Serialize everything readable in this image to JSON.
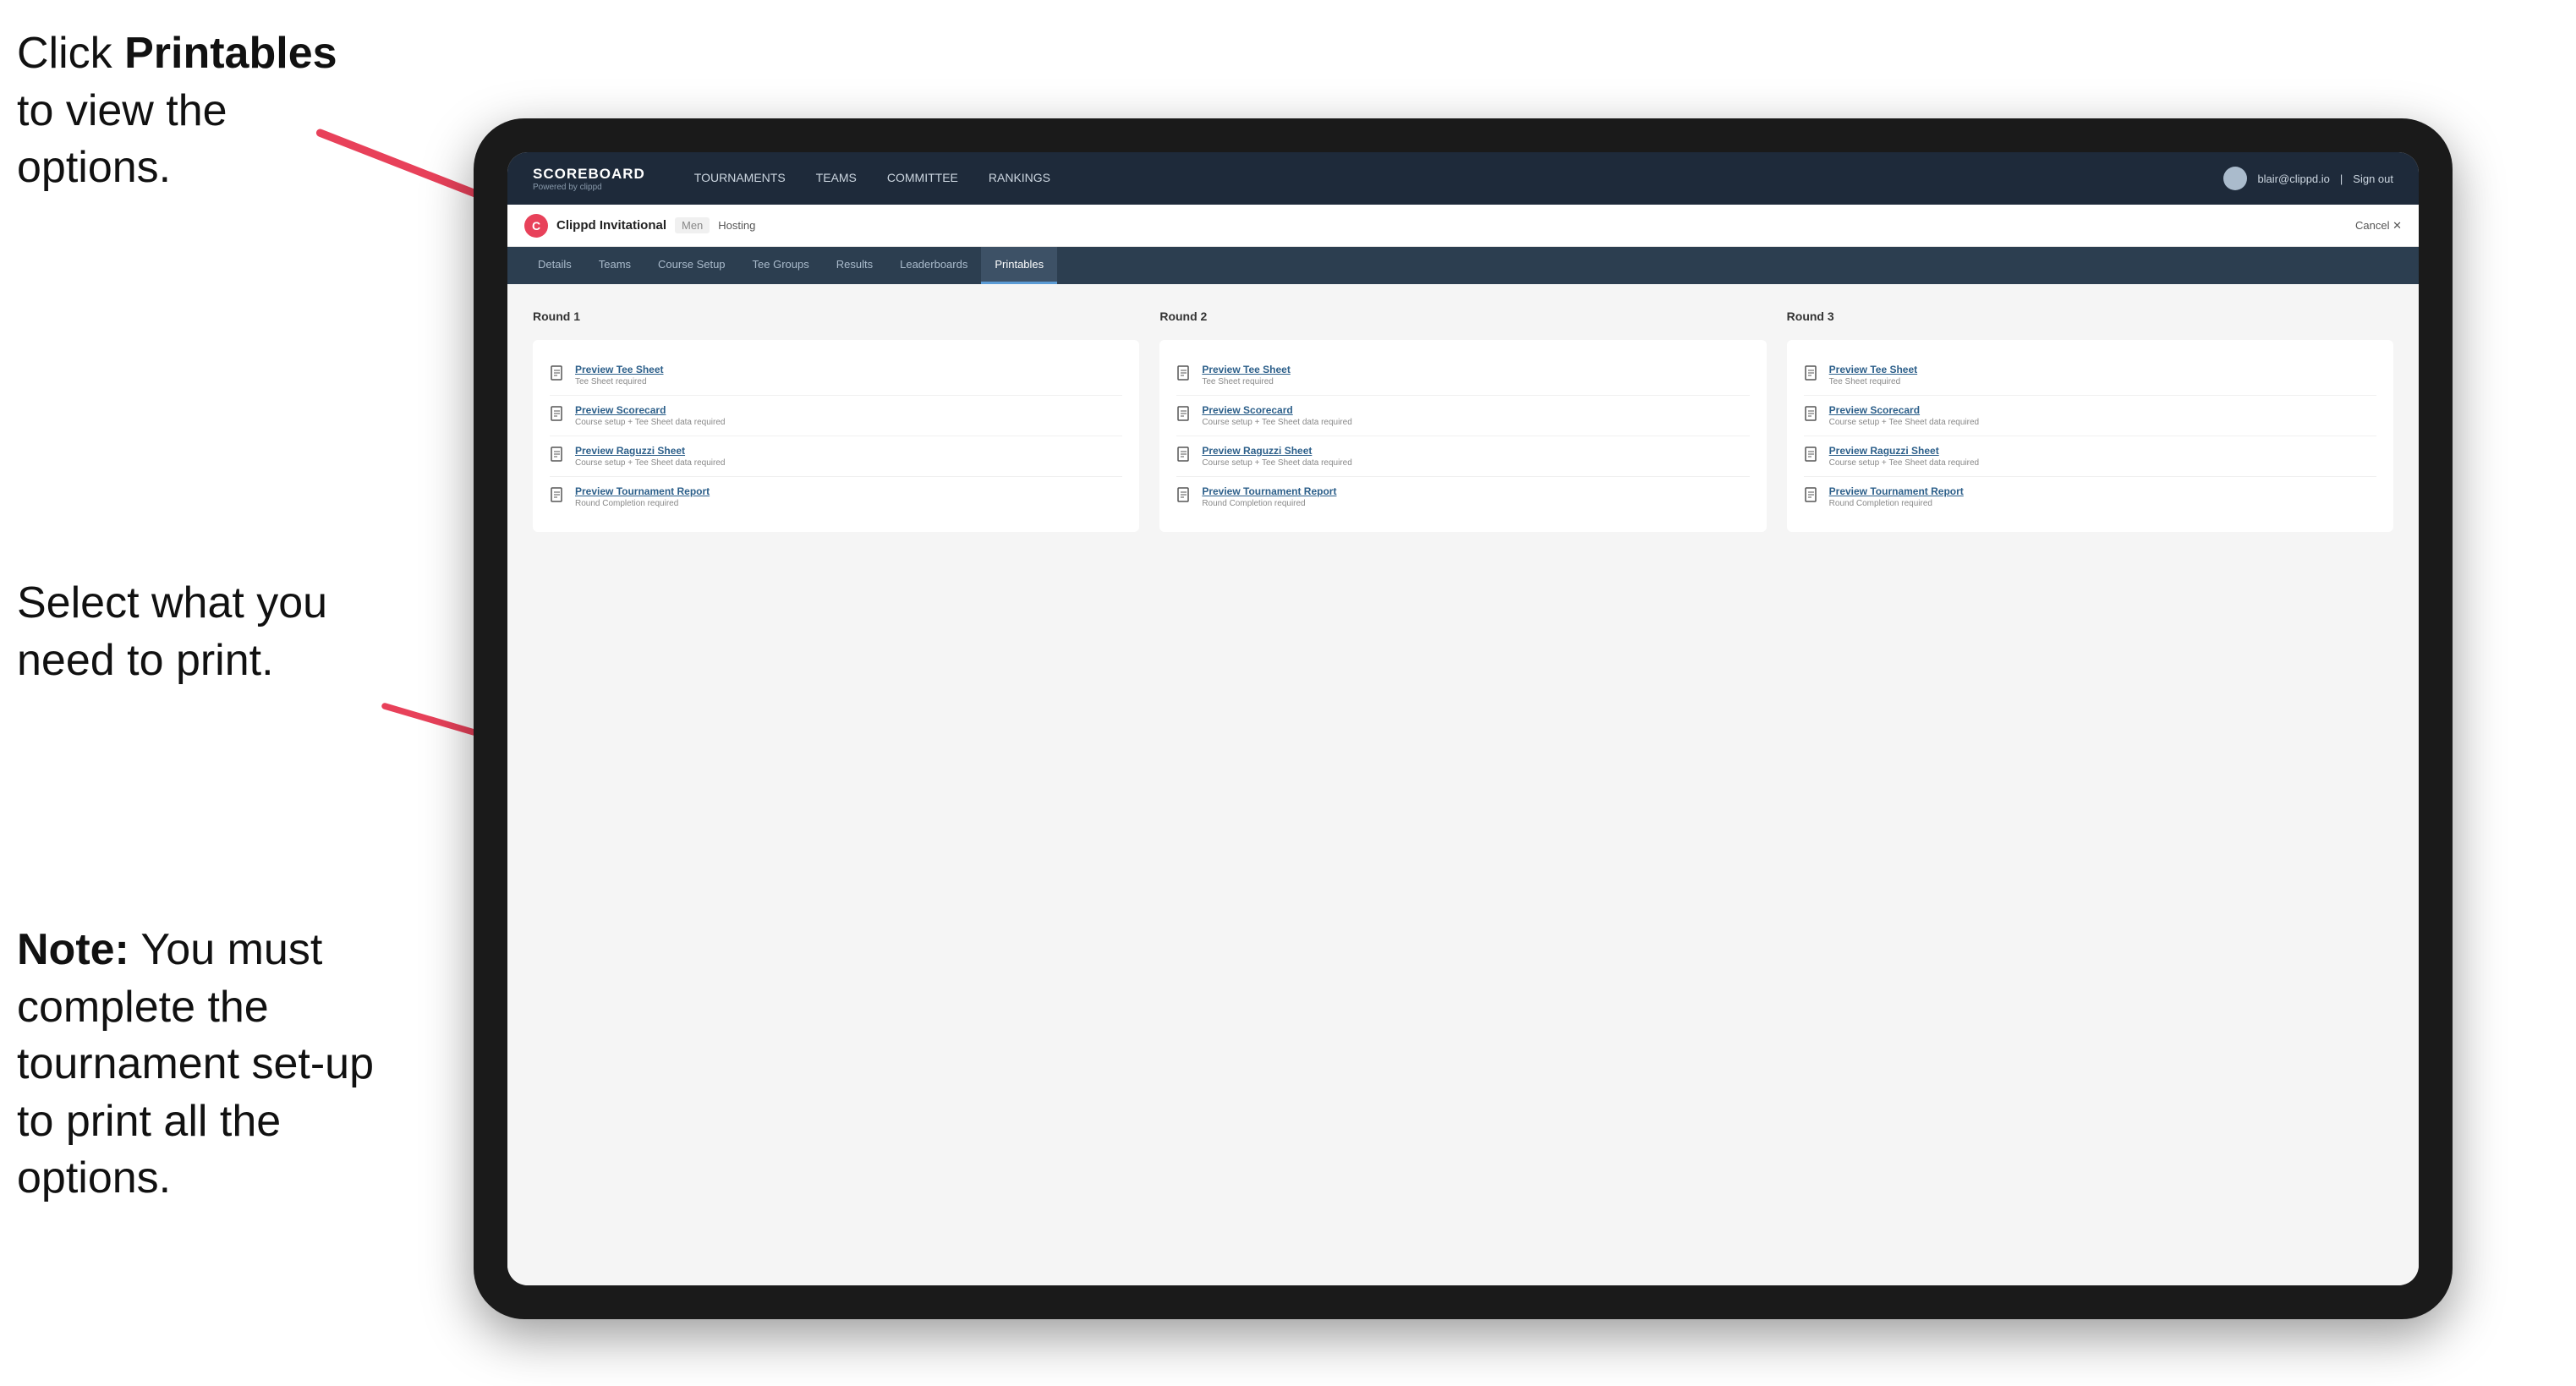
{
  "instructions": {
    "top": "Click ",
    "top_bold": "Printables",
    "top_rest": " to view the options.",
    "mid": "Select what you need to print.",
    "bottom_bold": "Note:",
    "bottom_rest": " You must complete the tournament set-up to print all the options."
  },
  "nav": {
    "brand": "SCOREBOARD",
    "brand_sub": "Powered by clippd",
    "items": [
      {
        "label": "TOURNAMENTS",
        "active": false
      },
      {
        "label": "TEAMS",
        "active": false
      },
      {
        "label": "COMMITTEE",
        "active": false
      },
      {
        "label": "RANKINGS",
        "active": false
      }
    ],
    "user_email": "blair@clippd.io",
    "sign_out": "Sign out"
  },
  "sub_nav": {
    "logo_letter": "C",
    "tournament_name": "Clippd Invitational",
    "tournament_type": "Men",
    "tournament_status": "Hosting",
    "cancel": "Cancel ✕"
  },
  "tabs": [
    {
      "label": "Details",
      "active": false
    },
    {
      "label": "Teams",
      "active": false
    },
    {
      "label": "Course Setup",
      "active": false
    },
    {
      "label": "Tee Groups",
      "active": false
    },
    {
      "label": "Results",
      "active": false
    },
    {
      "label": "Leaderboards",
      "active": false
    },
    {
      "label": "Printables",
      "active": true
    }
  ],
  "rounds": [
    {
      "title": "Round 1",
      "items": [
        {
          "label": "Preview Tee Sheet",
          "sublabel": "Tee Sheet required"
        },
        {
          "label": "Preview Scorecard",
          "sublabel": "Course setup + Tee Sheet data required"
        },
        {
          "label": "Preview Raguzzi Sheet",
          "sublabel": "Course setup + Tee Sheet data required"
        },
        {
          "label": "Preview Tournament Report",
          "sublabel": "Round Completion required"
        }
      ]
    },
    {
      "title": "Round 2",
      "items": [
        {
          "label": "Preview Tee Sheet",
          "sublabel": "Tee Sheet required"
        },
        {
          "label": "Preview Scorecard",
          "sublabel": "Course setup + Tee Sheet data required"
        },
        {
          "label": "Preview Raguzzi Sheet",
          "sublabel": "Course setup + Tee Sheet data required"
        },
        {
          "label": "Preview Tournament Report",
          "sublabel": "Round Completion required"
        }
      ]
    },
    {
      "title": "Round 3",
      "items": [
        {
          "label": "Preview Tee Sheet",
          "sublabel": "Tee Sheet required"
        },
        {
          "label": "Preview Scorecard",
          "sublabel": "Course setup + Tee Sheet data required"
        },
        {
          "label": "Preview Raguzzi Sheet",
          "sublabel": "Course setup + Tee Sheet data required"
        },
        {
          "label": "Preview Tournament Report",
          "sublabel": "Round Completion required"
        }
      ]
    }
  ]
}
